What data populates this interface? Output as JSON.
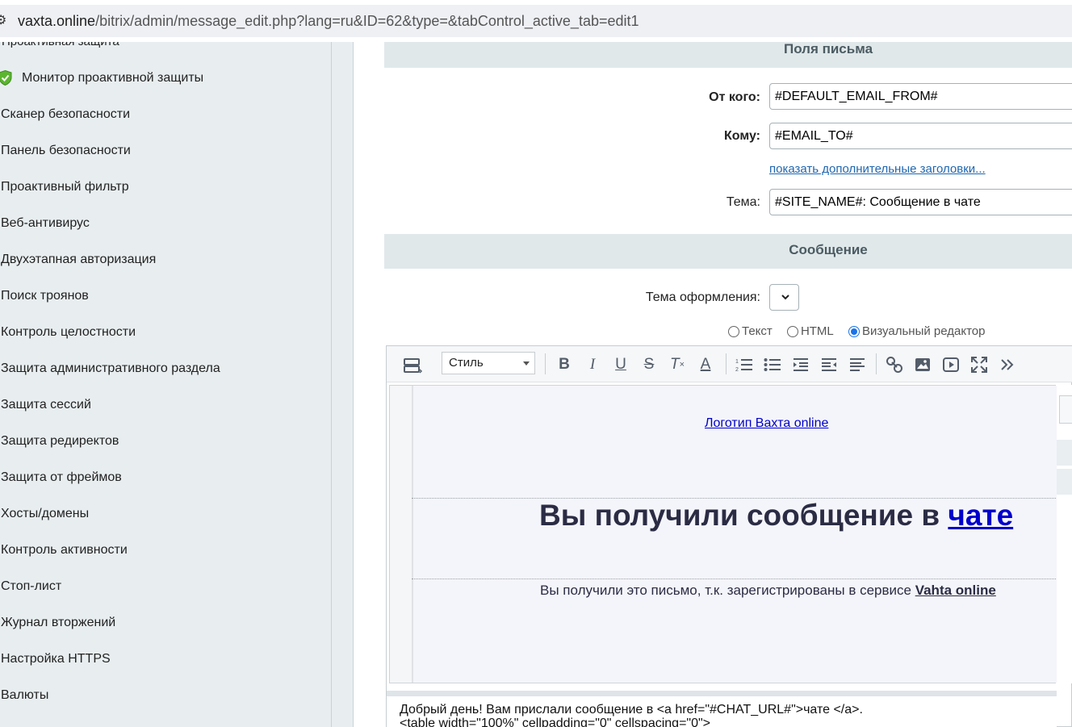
{
  "browser": {
    "url_host": "vaxta.online",
    "url_path": "/bitrix/admin/message_edit.php?lang=ru&ID=62&type=&tabControl_active_tab=edit1"
  },
  "sidebar": {
    "cut_item": "Проактивная защита",
    "items": [
      {
        "label": "Монитор проактивной защиты",
        "icon": "shield-check-icon"
      },
      {
        "label": "Сканер безопасности"
      },
      {
        "label": "Панель безопасности"
      },
      {
        "label": "Проактивный фильтр"
      },
      {
        "label": "Веб-антивирус"
      },
      {
        "label": "Двухэтапная авторизация"
      },
      {
        "label": "Поиск троянов"
      },
      {
        "label": "Контроль целостности"
      },
      {
        "label": "Защита административного раздела"
      },
      {
        "label": "Защита сессий"
      },
      {
        "label": "Защита редиректов"
      },
      {
        "label": "Защита от фреймов"
      },
      {
        "label": "Хосты/домены"
      },
      {
        "label": "Контроль активности"
      },
      {
        "label": "Стоп-лист"
      },
      {
        "label": "Журнал вторжений"
      },
      {
        "label": "Настройка HTTPS"
      },
      {
        "label": "Валюты"
      }
    ]
  },
  "form": {
    "section_fields": "Поля письма",
    "from_label": "От кого:",
    "from_value": "#DEFAULT_EMAIL_FROM#",
    "to_label": "Кому:",
    "to_value": "#EMAIL_TO#",
    "more_headers_link": "показать дополнительные заголовки...",
    "subject_label": "Тема:",
    "subject_value": "#SITE_NAME#: Сообщение в чате",
    "section_message": "Сообщение",
    "theme_label": "Тема оформления:",
    "format_options": [
      {
        "label": "Текст",
        "selected": false
      },
      {
        "label": "HTML",
        "selected": false
      },
      {
        "label": "Визуальный редактор",
        "selected": true
      }
    ]
  },
  "editor": {
    "style_select": "Стиль",
    "toolbar_icons": [
      "template-icon",
      "bold-icon",
      "italic-icon",
      "underline-icon",
      "strikethrough-icon",
      "remove-format-icon",
      "font-color-icon",
      "ordered-list-icon",
      "unordered-list-icon",
      "indent-icon",
      "outdent-icon",
      "align-icon",
      "link-icon",
      "image-icon",
      "video-icon",
      "fullscreen-icon",
      "more-icon"
    ],
    "logo_alt": "Логотип Вахта online",
    "title_prefix": "Вы получили сообщение в ",
    "title_link": "чате",
    "info_prefix": "Вы получили это письмо, т.к. зарегистрированы в сервисе ",
    "info_brand": "Vahta online",
    "source_line1": "Добрый день! Вам прислали сообщение в <a href=\"#CHAT_URL#\">чате </a>.",
    "source_line2": "<table width=\"100%\" cellpadding=\"0\" cellspacing=\"0\">"
  }
}
